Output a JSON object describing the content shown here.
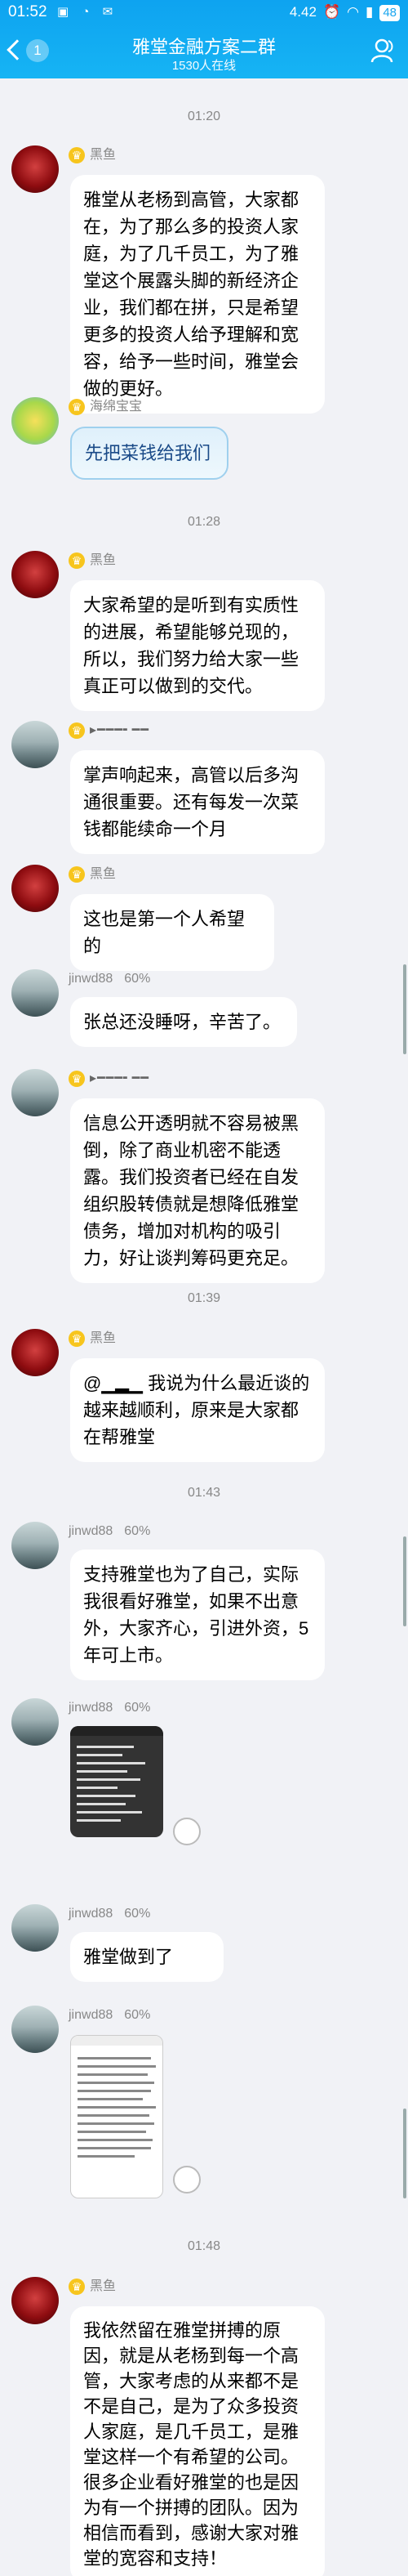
{
  "status": {
    "time": "01:52",
    "speed": "4.42",
    "battery": "48",
    "colors": {
      "header": "#0ea3f0"
    }
  },
  "header": {
    "back_count": "1",
    "title": "雅堂金融方案二群",
    "online": "1530人在线"
  },
  "chat": {
    "timestamps": [
      "01:20",
      "01:28",
      "01:39",
      "01:43",
      "01:48"
    ],
    "messages": [
      {
        "sender": "黑鱼",
        "text": "雅堂从老杨到高管，大家都在，为了那么多的投资人家庭，为了几千员工，为了雅堂这个展露头脚的新经济企业，我们都在拼，只是希望更多的投资人给予理解和宽容，给予一些时间，雅堂会做的更好。"
      },
      {
        "sender": "海绵宝宝",
        "text": "先把菜钱给我们"
      },
      {
        "sender": "黑鱼",
        "text": "大家希望的是听到有实质性的进展，希望能够兑现的，所以，我们努力给大家一些真正可以做到的交代。"
      },
      {
        "sender": "",
        "text": "掌声响起来，高管以后多沟通很重要。还有每发一次菜钱都能续命一个月"
      },
      {
        "sender": "黑鱼",
        "text": "这也是第一个人希望的"
      },
      {
        "sender": "jinwd88",
        "pct": "60%",
        "text": "张总还没睡呀，辛苦了。"
      },
      {
        "sender": "",
        "text": "信息公开透明就不容易被黑倒，除了商业机密不能透露。我们投资者已经在自发组织股转债就是想降低雅堂债务，增加对机构的吸引力，好让谈判筹码更充足。"
      },
      {
        "sender": "黑鱼",
        "at": "@",
        "text": " 我说为什么最近谈的越来越顺利，原来是大家都在帮雅堂"
      },
      {
        "sender": "jinwd88",
        "pct": "60%",
        "text": "支持雅堂也为了自己，实际我很看好雅堂，如果不出意外，大家齐心，引进外资，5年可上市。"
      },
      {
        "sender": "jinwd88",
        "pct": "60%",
        "text": ""
      },
      {
        "sender": "jinwd88",
        "pct": "60%",
        "text": "雅堂做到了"
      },
      {
        "sender": "jinwd88",
        "pct": "60%",
        "text": ""
      },
      {
        "sender": "黑鱼",
        "text": "我依然留在雅堂拼搏的原因，就是从老杨到每一个高管，大家考虑的从来都不是不是自己，是为了众多投资人家庭，是几千员工，是雅堂这样一个有希望的公司。很多企业看好雅堂的也是因为有一个拼搏的团队。因为相信而看到，感谢大家对雅堂的宽容和支持！"
      }
    ]
  }
}
